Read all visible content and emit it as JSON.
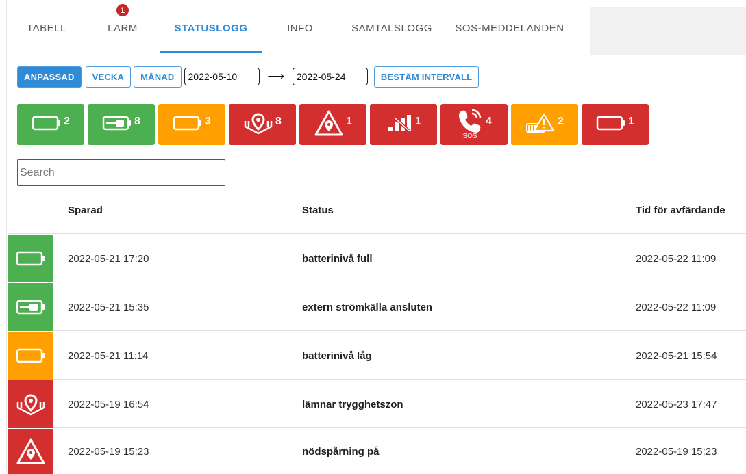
{
  "tabs": [
    {
      "label": "TABELL",
      "active": false
    },
    {
      "label": "LARM",
      "active": false,
      "badge": "1"
    },
    {
      "label": "STATUSLOGG",
      "active": true
    },
    {
      "label": "INFO",
      "active": false
    },
    {
      "label": "SAMTALSLOGG",
      "active": false
    },
    {
      "label": "SOS-MEDDELANDEN",
      "active": false
    }
  ],
  "toolbar": {
    "custom_label": "ANPASSAD",
    "week_label": "VECKA",
    "month_label": "MÅNAD",
    "from_date": "2022-05-10",
    "to_date": "2022-05-24",
    "arrow": "⟶",
    "interval_label": "BESTÄM INTERVALL"
  },
  "tiles": [
    {
      "icon": "battery-full-icon",
      "color": "#4caf50",
      "count": "2"
    },
    {
      "icon": "battery-charging-icon",
      "color": "#4caf50",
      "count": "8"
    },
    {
      "icon": "battery-low-icon",
      "color": "#ffa000",
      "count": "3"
    },
    {
      "icon": "geofence-exit-icon",
      "color": "#d32f2f",
      "count": "8"
    },
    {
      "icon": "emergency-tracking-icon",
      "color": "#d32f2f",
      "count": "1"
    },
    {
      "icon": "signal-lost-icon",
      "color": "#d32f2f",
      "count": "1"
    },
    {
      "icon": "sos-call-icon",
      "color": "#d32f2f",
      "count": "4",
      "sub": "SOS"
    },
    {
      "icon": "battery-warning-icon",
      "color": "#ffa000",
      "count": "2"
    },
    {
      "icon": "battery-empty-icon",
      "color": "#d32f2f",
      "count": "1"
    }
  ],
  "search": {
    "placeholder": "Search",
    "value": ""
  },
  "table": {
    "headers": {
      "saved": "Sparad",
      "status": "Status",
      "dismissed": "Tid för avfärdande"
    },
    "rows": [
      {
        "icon": "battery-full-icon",
        "color": "#4caf50",
        "saved": "2022-05-21 17:20",
        "status": "batterinivå full",
        "dismissed": "2022-05-22 11:09"
      },
      {
        "icon": "battery-charging-icon",
        "color": "#4caf50",
        "saved": "2022-05-21 15:35",
        "status": "extern strömkälla ansluten",
        "dismissed": "2022-05-22 11:09"
      },
      {
        "icon": "battery-low-icon",
        "color": "#ffa000",
        "saved": "2022-05-21 11:14",
        "status": "batterinivå låg",
        "dismissed": "2022-05-21 15:54"
      },
      {
        "icon": "geofence-exit-icon",
        "color": "#d32f2f",
        "saved": "2022-05-19 16:54",
        "status": "lämnar trygghetszon",
        "dismissed": "2022-05-23 17:47"
      },
      {
        "icon": "emergency-tracking-icon",
        "color": "#d32f2f",
        "saved": "2022-05-19 15:23",
        "status": "nödspårning på",
        "dismissed": "2022-05-19 15:23"
      }
    ]
  }
}
